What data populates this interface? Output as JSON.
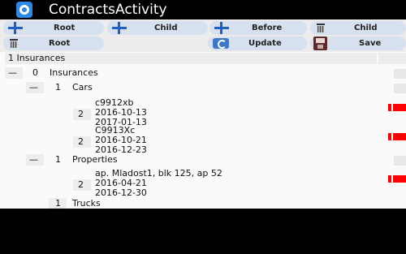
{
  "app": {
    "title": "ContractsActivity"
  },
  "toolbar": {
    "root_add": "Root",
    "child_add": "Child",
    "before_add": "Before",
    "child_delete": "Child",
    "root_delete": "Root",
    "update": "Update",
    "save": "Save"
  },
  "tree": {
    "header": "1 Insurances",
    "root": {
      "toggle": "—",
      "level": "0",
      "label": "Insurances"
    },
    "cars": {
      "toggle": "—",
      "level": "1",
      "label": "Cars"
    },
    "cars_items": [
      {
        "level": "2",
        "lines": [
          "c9912xb",
          "2016-10-13",
          "2017-01-13"
        ]
      },
      {
        "level": "2",
        "lines": [
          "C9913Xc",
          "2016-10-21",
          "2016-12-23"
        ]
      }
    ],
    "properties": {
      "toggle": "—",
      "level": "1",
      "label": "Properties"
    },
    "properties_items": [
      {
        "level": "2",
        "lines": [
          "ap. Mladost1, blk 125, ap 52",
          "2016-04-21",
          "2016-12-30"
        ]
      }
    ],
    "trucks": {
      "level": "1",
      "label": "Trucks"
    }
  }
}
